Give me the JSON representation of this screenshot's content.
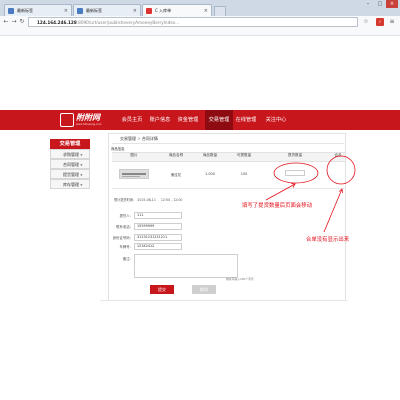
{
  "browser": {
    "tabs": [
      {
        "label": "最新标签"
      },
      {
        "label": "最新标签"
      },
      {
        "label": "C 入库单"
      }
    ],
    "url": "124.164.246.128",
    "url_rest": ":8090/urt/user/publisheveryAmoneyBerryIndex..."
  },
  "site": {
    "logo_text": "附附网",
    "logo_sub": "www.fufuwang.com",
    "nav": [
      {
        "label": "会员主页"
      },
      {
        "label": "账户信息"
      },
      {
        "label": "资金管理"
      },
      {
        "label": "交易管理"
      },
      {
        "label": "在线管理"
      },
      {
        "label": "关注中心"
      }
    ]
  },
  "sidebar": {
    "title": "交易管理",
    "items": [
      {
        "label": "求购管理"
      },
      {
        "label": "合同管理"
      },
      {
        "label": "提货管理"
      },
      {
        "label": "库存管理"
      }
    ]
  },
  "main": {
    "breadcrumb": [
      "交易管理",
      "合同详情"
    ],
    "section_title": "商品信息",
    "columns": [
      "图片",
      "商品名称",
      "商品数量",
      "可提数量",
      "提货数量",
      "合名"
    ],
    "row": {
      "name": "雅佳花",
      "quantity": "1.000",
      "available": "100"
    },
    "time_label": "预计提货时间：",
    "time_value": "2015-08-11",
    "time_extra": "12:00 - 12:00",
    "fields": [
      {
        "label": "提货人：",
        "value": "111"
      },
      {
        "label": "联系电话：",
        "value": "15599999"
      },
      {
        "label": "身份证号码：",
        "value": "31231231231211"
      },
      {
        "label": "车牌号：",
        "value": "12342412"
      }
    ],
    "notes_label": "备注：",
    "notes_count": "剩余可输入200个字符",
    "submit_label": "提交",
    "cancel_label": "取消"
  },
  "annotations": {
    "note1": "填写了提货数量后页面会移动",
    "note2": "合单没有显示出来",
    "color": "#e4111b"
  }
}
